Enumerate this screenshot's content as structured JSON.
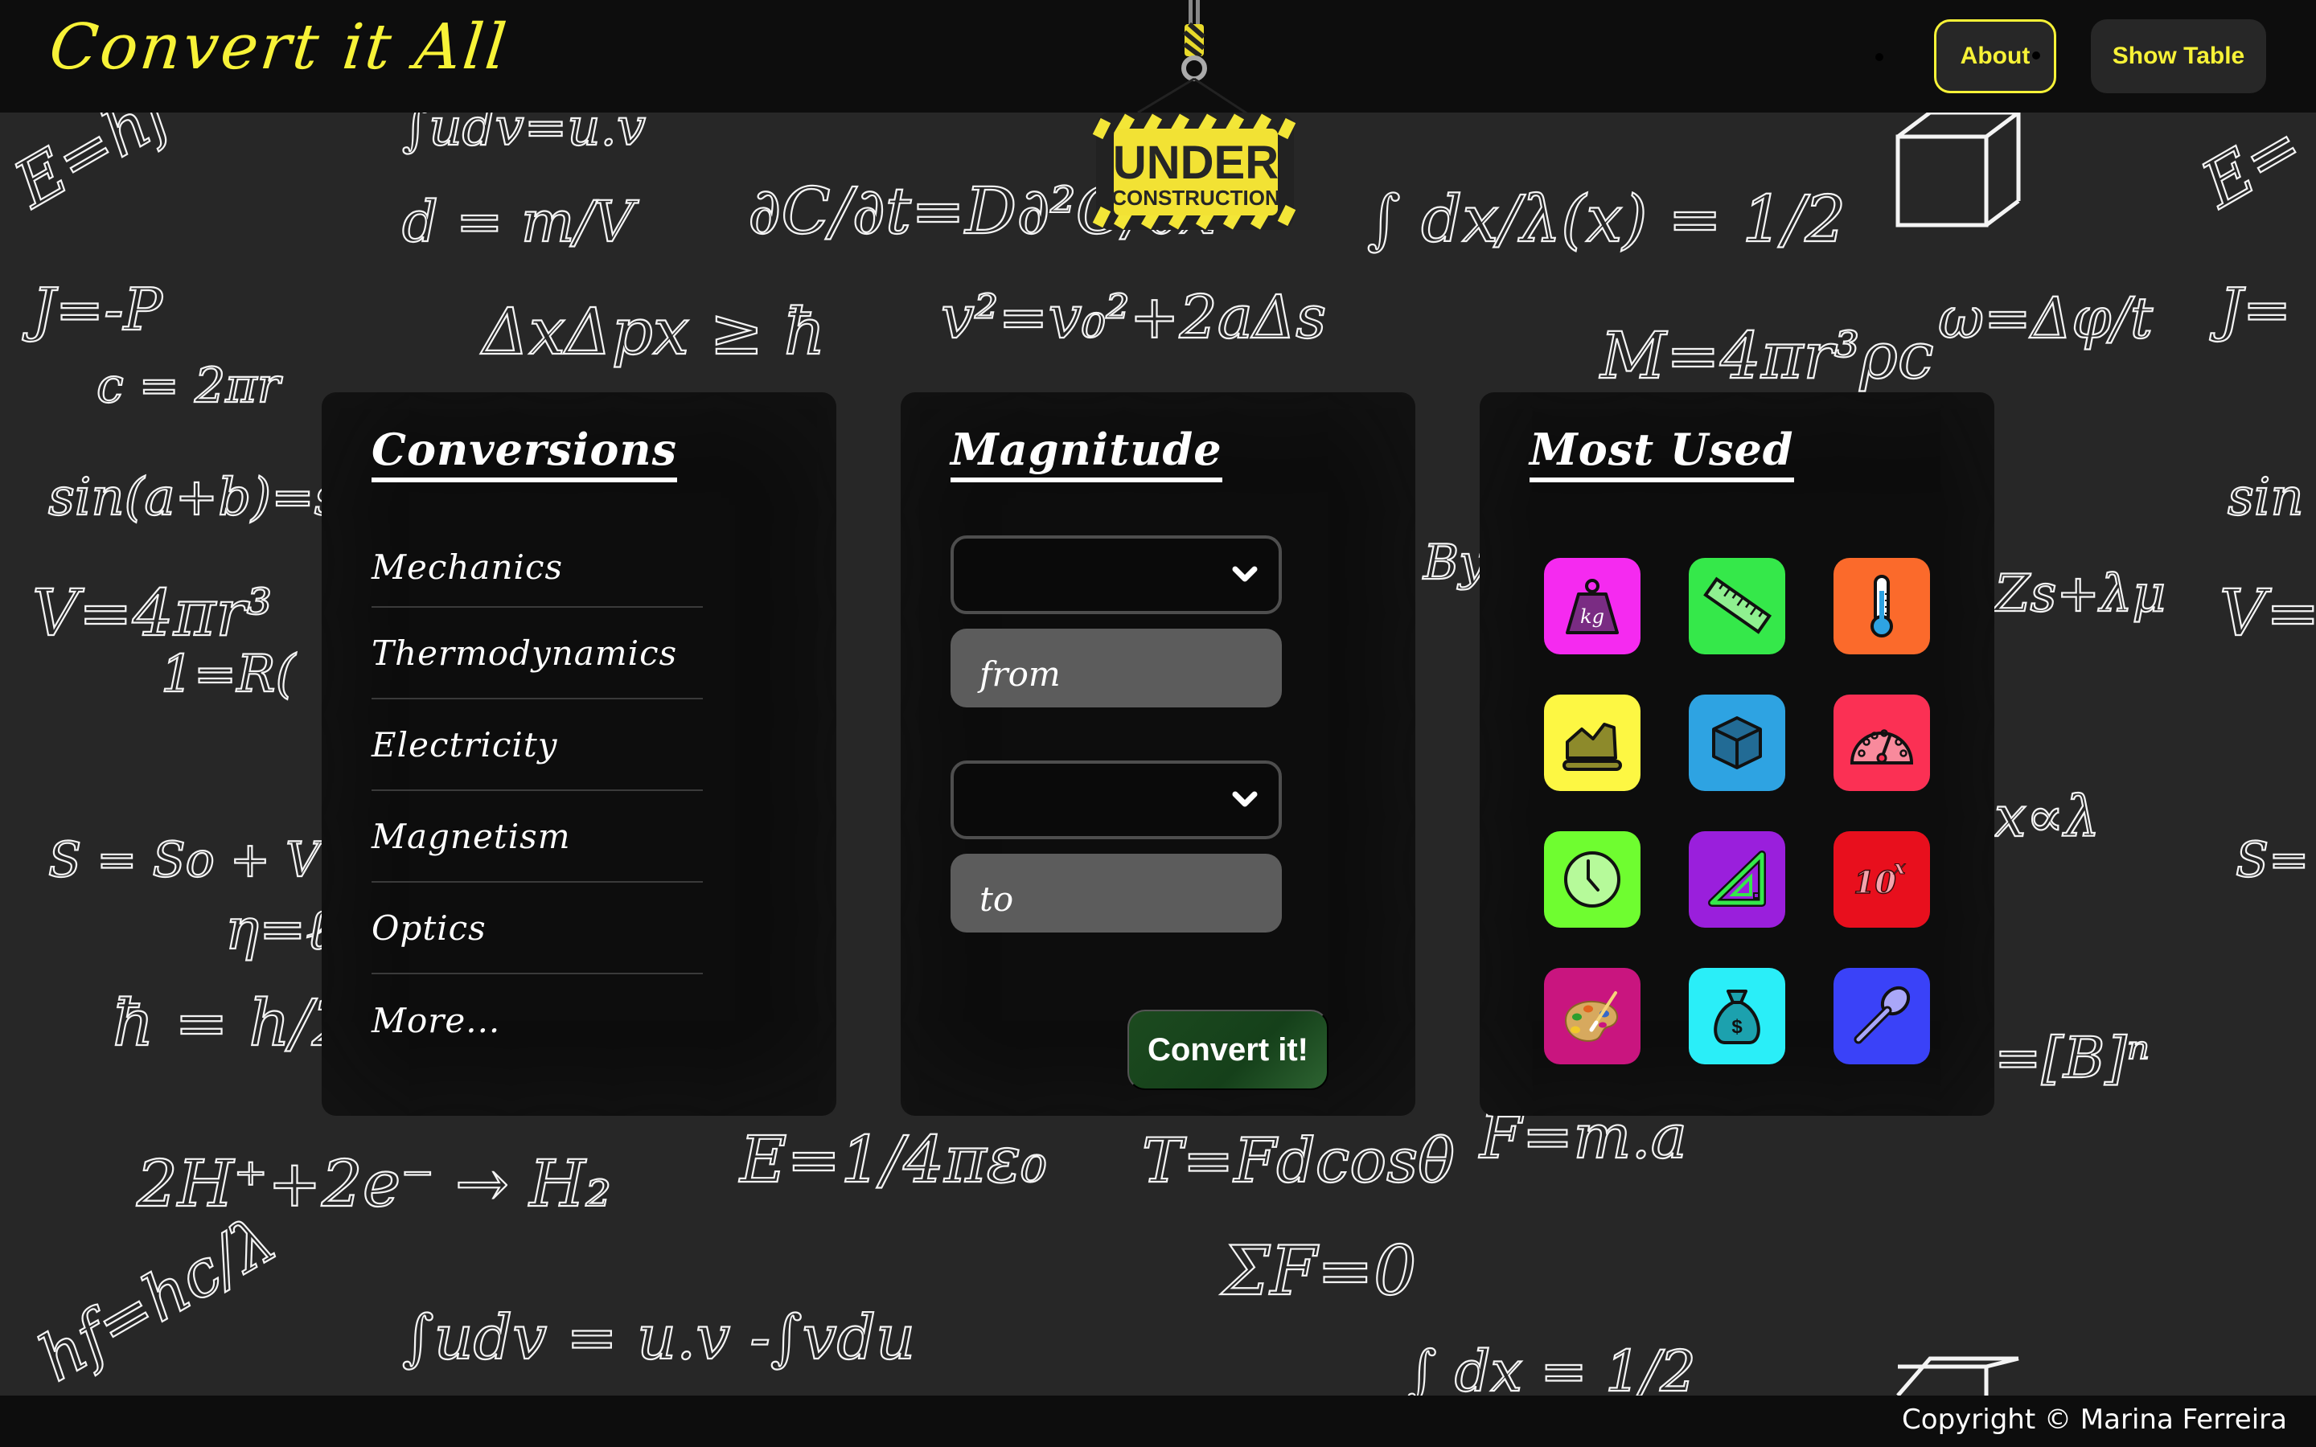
{
  "header": {
    "brand": "Convert it All",
    "nav": [
      {
        "label": "About",
        "active": true
      },
      {
        "label": "Show Table",
        "active": false
      }
    ],
    "banner": {
      "line1": "UNDER",
      "line2": "CONSTRUCTION"
    }
  },
  "conversions": {
    "title": "Conversions",
    "items": [
      "Mechanics",
      "Thermodynamics",
      "Electricity",
      "Magnetism",
      "Optics",
      "More..."
    ]
  },
  "magnitude": {
    "title": "Magnitude",
    "from_unit_select": {
      "value": "",
      "icon": "chevron-down-icon"
    },
    "from_input": {
      "placeholder": "from",
      "value": ""
    },
    "to_unit_select": {
      "value": "",
      "icon": "chevron-down-icon"
    },
    "to_input": {
      "placeholder": "to",
      "value": ""
    },
    "convert_label": "Convert it!"
  },
  "most_used": {
    "title": "Most Used",
    "tiles": [
      {
        "icon": "mass-weight-kg-icon",
        "label": "kg",
        "color": "#f52af0"
      },
      {
        "icon": "length-ruler-icon",
        "color": "#35e84a"
      },
      {
        "icon": "temperature-thermometer-icon",
        "color": "#fb6a2b"
      },
      {
        "icon": "area-land-icon",
        "color": "#fdf743"
      },
      {
        "icon": "volume-cube-icon",
        "color": "#2ea3e2"
      },
      {
        "icon": "pressure-gauge-icon",
        "color": "#fb3054"
      },
      {
        "icon": "time-clock-icon",
        "color": "#6ffd30"
      },
      {
        "icon": "angle-set-square-icon",
        "color": "#9a1fdc"
      },
      {
        "icon": "scientific-notation-icon",
        "label": "10",
        "sup": "x",
        "color": "#e80f1d"
      },
      {
        "icon": "color-palette-icon",
        "color": "#c9157f"
      },
      {
        "icon": "currency-money-bag-icon",
        "label": "$",
        "color": "#2aeef8"
      },
      {
        "icon": "cooking-spoon-icon",
        "color": "#3a42f8"
      }
    ]
  },
  "footer": {
    "copyright": "Copyright © Marina Ferreira"
  },
  "colors": {
    "accent_yellow": "#f7f237",
    "header_bg": "#0d0d0d",
    "board_bg": "#272727",
    "convert_green": "#1c4a1f"
  }
}
